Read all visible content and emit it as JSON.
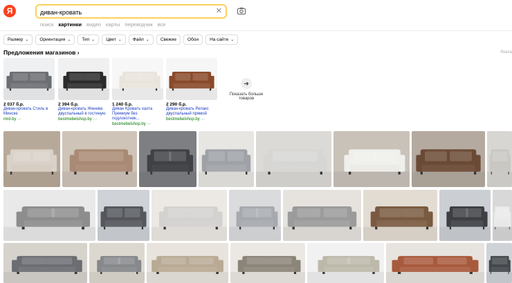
{
  "header": {
    "logo_letter": "Я",
    "search_value": "диван-кровать",
    "clear_icon": "close-icon",
    "camera_icon": "camera-icon"
  },
  "tabs": [
    {
      "label": "поиск",
      "active": false
    },
    {
      "label": "картинки",
      "active": true
    },
    {
      "label": "видео",
      "active": false
    },
    {
      "label": "карты",
      "active": false
    },
    {
      "label": "переводчик",
      "active": false
    },
    {
      "label": "все",
      "active": false
    }
  ],
  "filters": [
    {
      "label": "Размер",
      "dropdown": true
    },
    {
      "label": "Ориентация",
      "dropdown": true
    },
    {
      "label": "Тип",
      "dropdown": true
    },
    {
      "label": "Цвет",
      "dropdown": true
    },
    {
      "label": "Файл",
      "dropdown": true
    },
    {
      "label": "Свежие",
      "dropdown": false
    },
    {
      "label": "Обои",
      "dropdown": false
    },
    {
      "label": "На сайте",
      "dropdown": true
    }
  ],
  "offers": {
    "title": "Предложения магазинов ›",
    "ad_label": "Рекла",
    "items": [
      {
        "price": "2 037 б.р.",
        "name": "Диван-кровать Стиль в Минске",
        "shop": "mrd.by ···",
        "sofa": "#6b6e73",
        "bg": "#eef0f2"
      },
      {
        "price": "2 394 б.р.",
        "name": "Диван-кровать Женева двуспальный в гостиную",
        "shop": "bestmebelshop.by ···",
        "sofa": "#2b2b2b",
        "bg": "#f0f0f0"
      },
      {
        "price": "1 240 б.р.",
        "name": "Диван Кровать хаэта Премиум без подлокотник...",
        "shop": "bestmebelshop.by ···",
        "sofa": "#e9e4dc",
        "bg": "#f7f7f7"
      },
      {
        "price": "2 290 б.р.",
        "name": "Диван-кровать Релакс двуспальный прямой",
        "shop": "bestmebelshop.by ···",
        "sofa": "#8a4a2a",
        "bg": "#f6f6f6"
      }
    ],
    "more_label": "Показать больше товаров",
    "more_icon": "arrow-right-icon"
  },
  "grid": [
    {
      "bg": "#b7a99a",
      "sofa": "#d9d2c8"
    },
    {
      "bg": "#cfc4b8",
      "sofa": "#a98a74"
    },
    {
      "bg": "#7d7f82",
      "sofa": "#3f4145"
    },
    {
      "bg": "#e7e6e3",
      "sofa": "#9ea2a6"
    },
    {
      "bg": "#dcdad6",
      "sofa": "#d6d6d4"
    },
    {
      "bg": "#c9c2b9",
      "sofa": "#efefec"
    },
    {
      "bg": "#b4aaa0",
      "sofa": "#6b4a35"
    },
    {
      "bg": "#d8d6d2",
      "sofa": "#c9c7c2"
    },
    {
      "bg": "#e9e9e9",
      "sofa": "#8d8d8d"
    },
    {
      "bg": "#cfd2d6",
      "sofa": "#54575c"
    },
    {
      "bg": "#ece9e4",
      "sofa": "#d3d2cf"
    },
    {
      "bg": "#d9dbdd",
      "sofa": "#a6aaae"
    },
    {
      "bg": "#e6e3df",
      "sofa": "#9b9b9b"
    },
    {
      "bg": "#e3dcd2",
      "sofa": "#7a5a40"
    },
    {
      "bg": "#cbcfd3",
      "sofa": "#3e3f42"
    },
    {
      "bg": "#d8d8d8",
      "sofa": "#eaeaea"
    },
    {
      "bg": "#d6d2cc",
      "sofa": "#6a6d72"
    },
    {
      "bg": "#ddd8cf",
      "sofa": "#86888b"
    },
    {
      "bg": "#e8e4dd",
      "sofa": "#b9aa94"
    },
    {
      "bg": "#ebe8e3",
      "sofa": "#8b8478"
    },
    {
      "bg": "#f1f1f1",
      "sofa": "#bdb9aa"
    },
    {
      "bg": "#e7e3de",
      "sofa": "#a85a3c"
    },
    {
      "bg": "#cfd3d7",
      "sofa": "#44474b"
    }
  ]
}
